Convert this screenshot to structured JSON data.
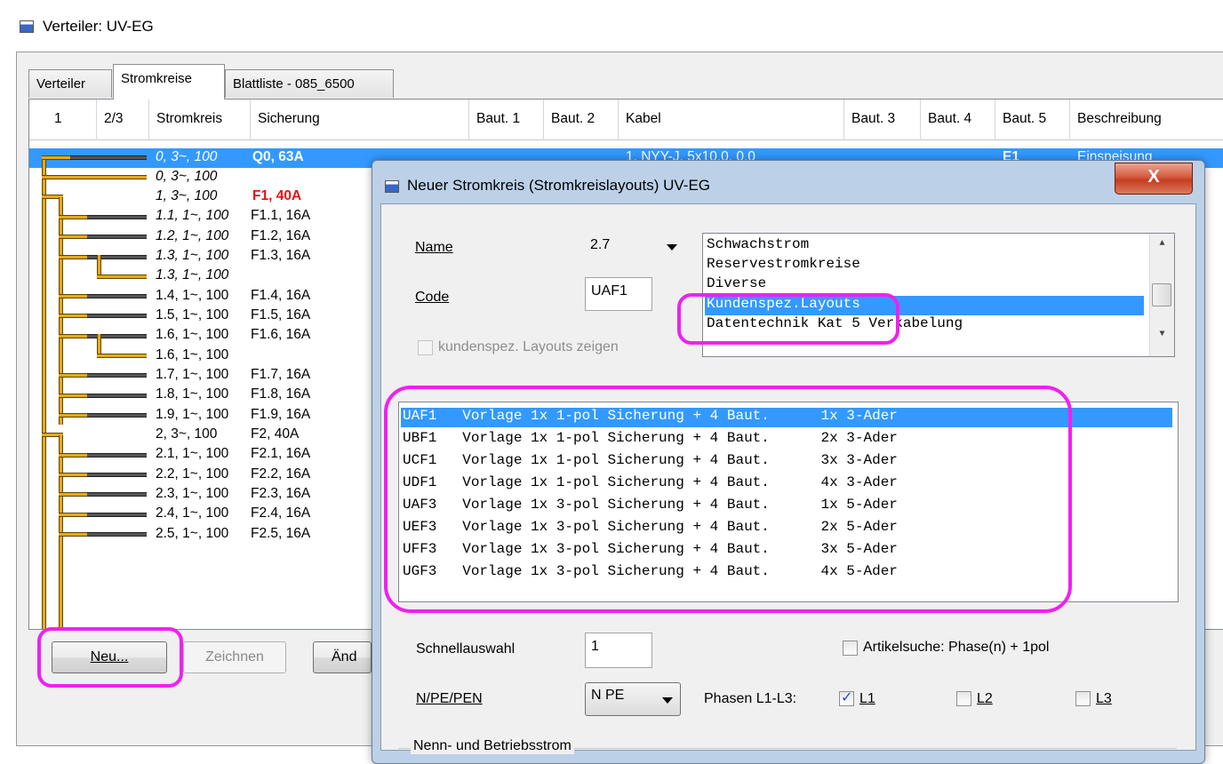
{
  "main_window": {
    "title": "Verteiler:  UV-EG",
    "tabs": [
      {
        "label": "Verteiler"
      },
      {
        "label": "Stromkreise"
      },
      {
        "label": "Blattliste - 085_6500"
      }
    ]
  },
  "grid": {
    "columns": [
      "1",
      "2/3",
      "Stromkreis",
      "Sicherung",
      "Baut. 1",
      "Baut. 2",
      "Kabel",
      "Baut. 3",
      "Baut. 4",
      "Baut. 5",
      "Beschreibung"
    ],
    "selected_row": {
      "stromkreis": "0, 3~, 100",
      "sicherung": "Q0, 63A",
      "kabel": "1, NYY-J, 5x10.0, 0.0",
      "baut5": "E1",
      "beschreibung": "Einspeisung"
    },
    "rows": [
      {
        "stromkreis": "0, 3~, 100",
        "sicherung": ""
      },
      {
        "stromkreis": "1, 3~, 100",
        "sicherung": "F1, 40A"
      },
      {
        "stromkreis": "1.1, 1~, 100",
        "sicherung": "F1.1, 16A"
      },
      {
        "stromkreis": "1.2, 1~, 100",
        "sicherung": "F1.2, 16A"
      },
      {
        "stromkreis": "1.3, 1~, 100",
        "sicherung": "F1.3, 16A"
      },
      {
        "stromkreis": "1.3, 1~, 100",
        "sicherung": ""
      },
      {
        "stromkreis": "1.4, 1~, 100",
        "sicherung": "F1.4, 16A"
      },
      {
        "stromkreis": "1.5, 1~, 100",
        "sicherung": "F1.5, 16A"
      },
      {
        "stromkreis": "1.6, 1~, 100",
        "sicherung": "F1.6, 16A"
      },
      {
        "stromkreis": "1.6, 1~, 100",
        "sicherung": ""
      },
      {
        "stromkreis": "1.7, 1~, 100",
        "sicherung": "F1.7, 16A"
      },
      {
        "stromkreis": "1.8, 1~, 100",
        "sicherung": "F1.8, 16A"
      },
      {
        "stromkreis": "1.9, 1~, 100",
        "sicherung": "F1.9, 16A"
      },
      {
        "stromkreis": "2, 3~, 100",
        "sicherung": "F2, 40A"
      },
      {
        "stromkreis": "2.1, 1~, 100",
        "sicherung": "F2.1, 16A"
      },
      {
        "stromkreis": "2.2, 1~, 100",
        "sicherung": "F2.2, 16A"
      },
      {
        "stromkreis": "2.3, 1~, 100",
        "sicherung": "F2.3, 16A"
      },
      {
        "stromkreis": "2.4, 1~, 100",
        "sicherung": "F2.4, 16A"
      },
      {
        "stromkreis": "2.5, 1~, 100",
        "sicherung": "F2.5, 16A"
      }
    ]
  },
  "buttons": {
    "new": "Neu...",
    "draw": "Zeichnen",
    "change_partial": "Änd"
  },
  "dialog": {
    "title": "Neuer Stromkreis (Stromkreislayouts)  UV-EG",
    "close": "X",
    "name_label": "Name",
    "name_value": "2.7",
    "code_label": "Code",
    "code_value": "UAF1",
    "show_custom_label": "kundenspez. Layouts zeigen",
    "categories": [
      "Schwachstrom",
      "Reservestromkreise",
      "Diverse",
      "Kundenspez.Layouts",
      "Datentechnik Kat 5 Verkabelung"
    ],
    "selected_category": "Kundenspez.Layouts",
    "layouts": [
      "UAF1   Vorlage 1x 1-pol Sicherung + 4 Baut.      1x 3-Ader",
      "UBF1   Vorlage 1x 1-pol Sicherung + 4 Baut.      2x 3-Ader",
      "UCF1   Vorlage 1x 1-pol Sicherung + 4 Baut.      3x 3-Ader",
      "UDF1   Vorlage 1x 1-pol Sicherung + 4 Baut.      4x 3-Ader",
      "UAF3   Vorlage 1x 3-pol Sicherung + 4 Baut.      1x 5-Ader",
      "UEF3   Vorlage 1x 3-pol Sicherung + 4 Baut.      2x 5-Ader",
      "UFF3   Vorlage 1x 3-pol Sicherung + 4 Baut.      3x 5-Ader",
      "UGF3   Vorlage 1x 3-pol Sicherung + 4 Baut.      4x 5-Ader"
    ],
    "selected_layout": "UAF1",
    "quick_select_label": "Schnellauswahl",
    "quick_select_value": "1",
    "article_search_label": "Artikelsuche: Phase(n) + 1pol",
    "npe_label": "N/PE/PEN",
    "npe_value": "N PE",
    "phases_label": "Phasen L1-L3:",
    "phases": [
      {
        "label": "L1",
        "checked": true
      },
      {
        "label": "L2",
        "checked": false
      },
      {
        "label": "L3",
        "checked": false
      }
    ],
    "group_label": "Nenn- und Betriebsstrom"
  },
  "colors": {
    "selection": "#3399ff",
    "highlight": "#ee22ee",
    "tree_line": "#e8a917",
    "fuse_red": "#e21313"
  }
}
